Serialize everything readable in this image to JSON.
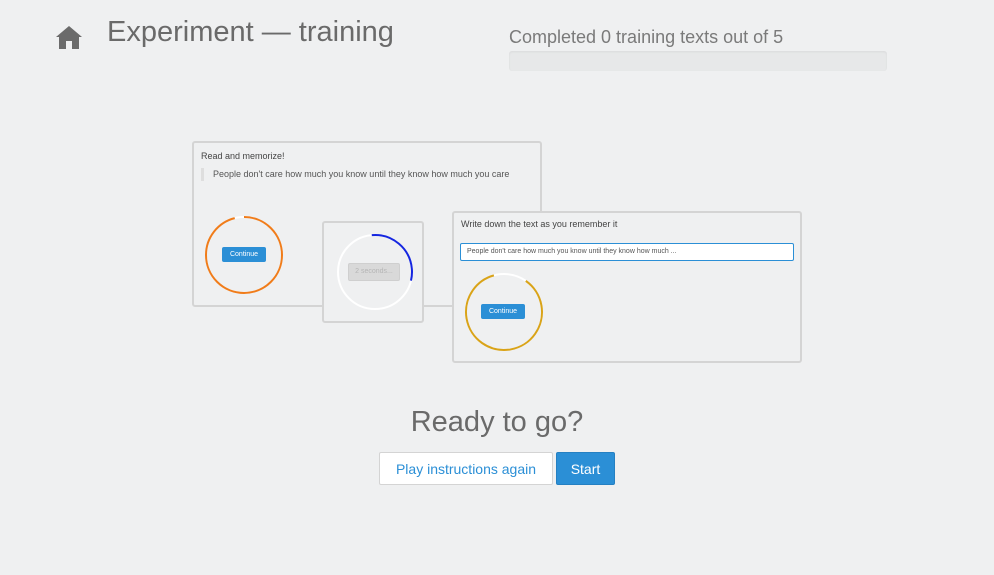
{
  "header": {
    "title": "Experiment — training",
    "home_icon": "home-icon",
    "progress": {
      "label": "Completed 0 training texts out of 5",
      "completed": 0,
      "total": 5,
      "fraction": 0
    }
  },
  "illustration": {
    "panel_read": {
      "heading": "Read and memorize!",
      "quote": "People don't care how much you know until they know how much you care",
      "button": "Continue",
      "ring_color": "#f07c1a"
    },
    "panel_wait": {
      "button": "2 seconds...",
      "ring_color": "#1526e0"
    },
    "panel_write": {
      "heading": "Write down the text as you remember it",
      "input_value": "People don't care how much you know until they know how much ...",
      "button": "Continue",
      "ring_color": "#d9a318"
    }
  },
  "cta": {
    "title": "Ready to go?",
    "replay_label": "Play instructions again",
    "start_label": "Start"
  },
  "colors": {
    "accent": "#2b8fd6",
    "background": "#eff0f1"
  }
}
